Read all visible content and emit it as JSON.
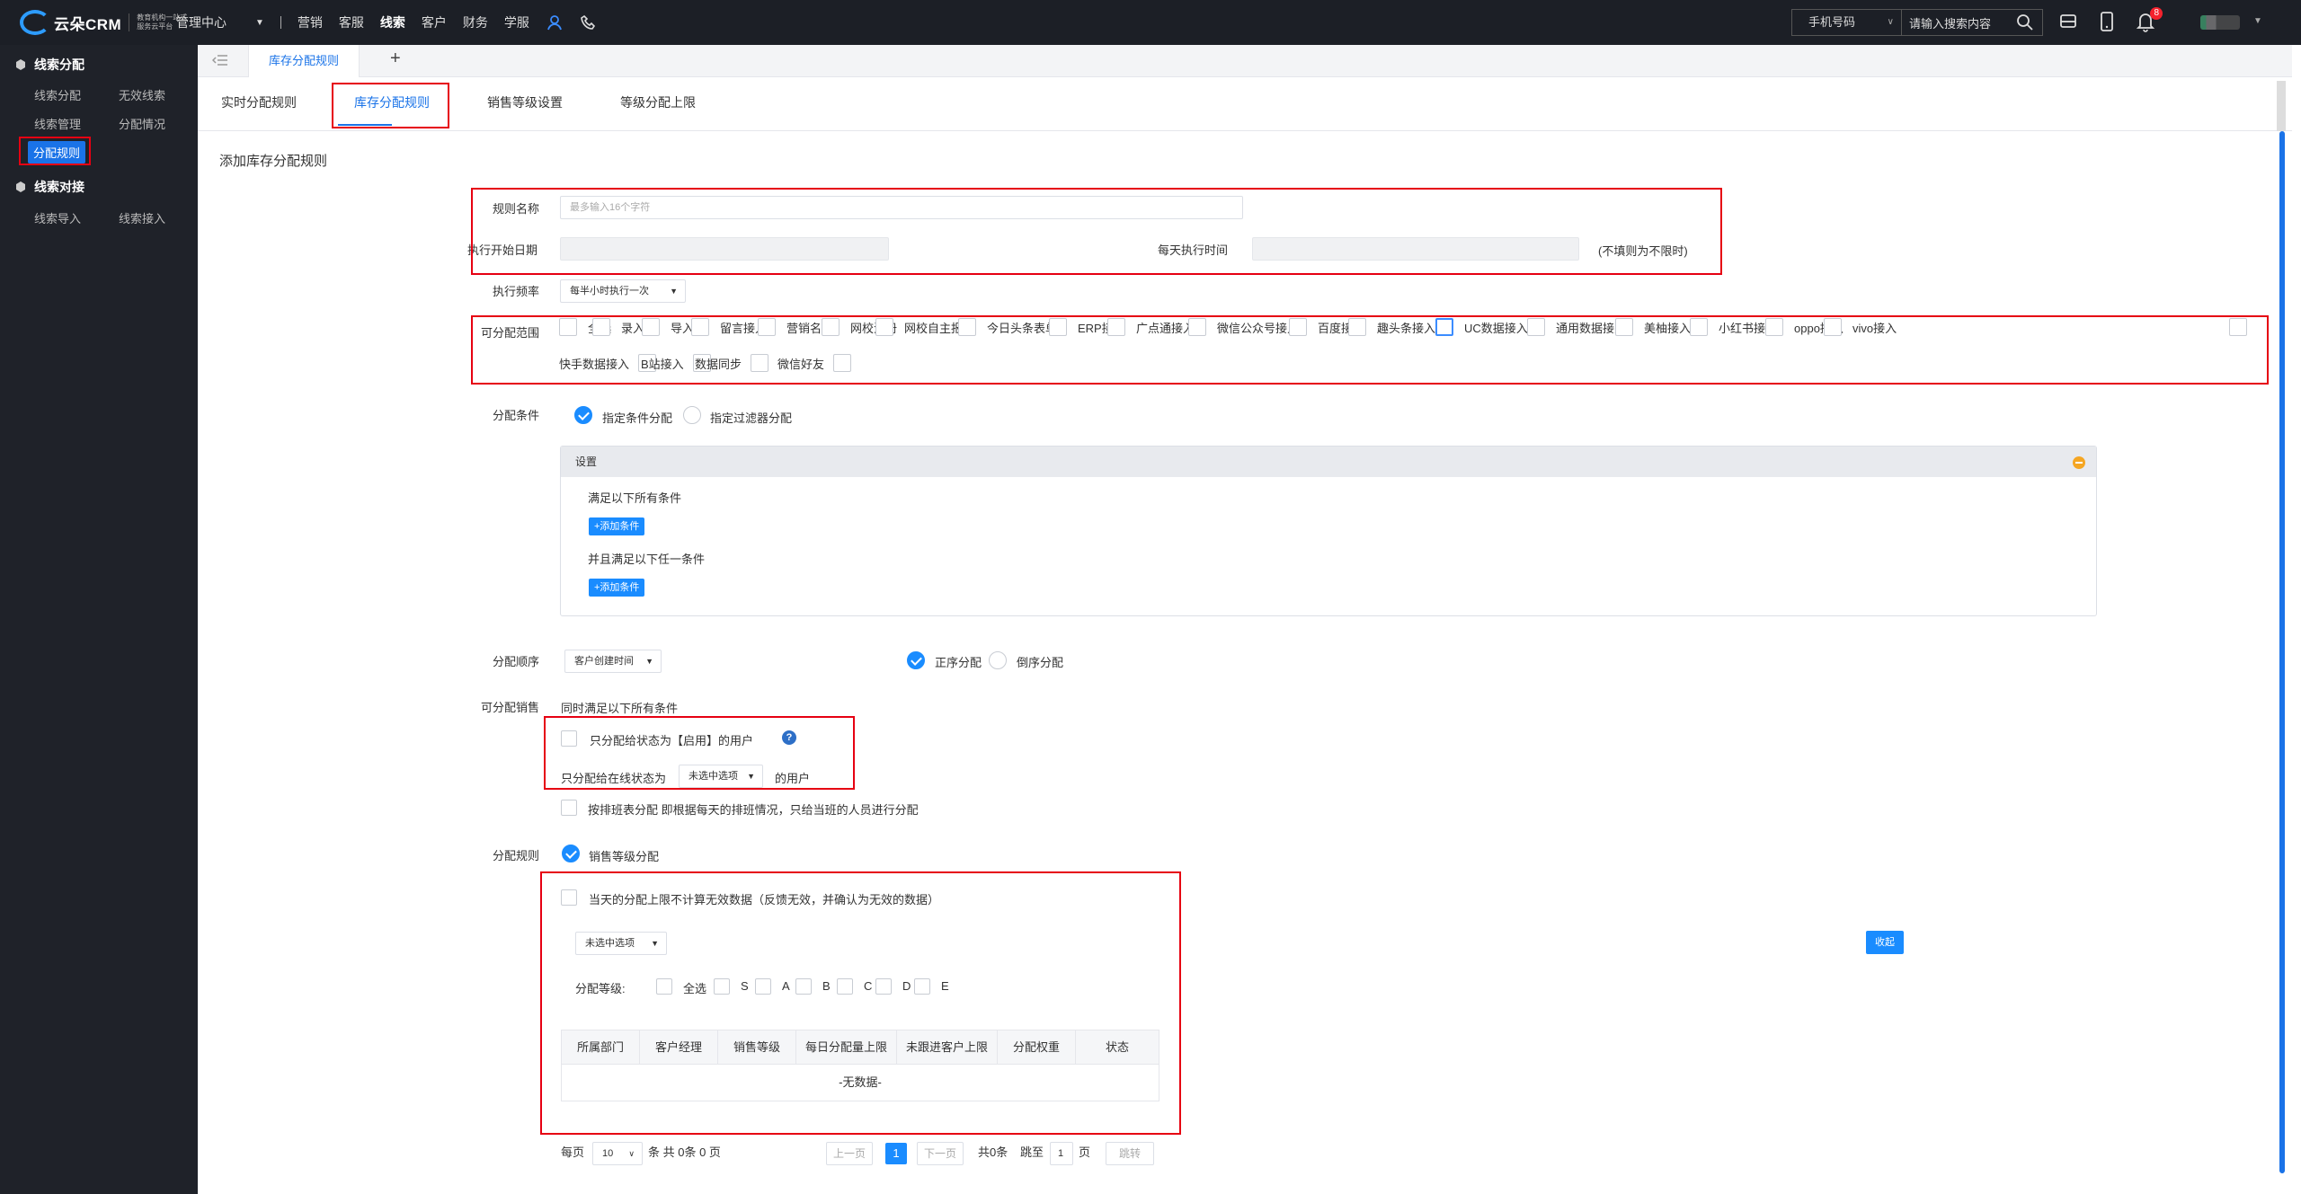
{
  "header": {
    "logo_text": "云朵CRM",
    "logo_sub": "教育机构一站式服务云平台",
    "nav_mgmt": "管理中心",
    "nav_items": [
      "营销",
      "客服",
      "线索",
      "客户",
      "财务",
      "学服"
    ],
    "search_type": "手机号码",
    "search_placeholder": "请输入搜索内容",
    "notif_count": "8"
  },
  "sidebar": {
    "group1": "线索分配",
    "group1_items": [
      "线索分配",
      "无效线索",
      "线索管理",
      "分配情况",
      "分配规则"
    ],
    "group2": "线索对接",
    "group2_items": [
      "线索导入",
      "线索接入"
    ]
  },
  "tabs": {
    "main": "库存分配规则",
    "add": "+"
  },
  "subtabs": [
    "实时分配规则",
    "库存分配规则",
    "销售等级设置",
    "等级分配上限"
  ],
  "form": {
    "page_title": "添加库存分配规则",
    "rule_name_label": "规则名称",
    "rule_name_placeholder": "最多输入16个字符",
    "start_date_label": "执行开始日期",
    "daily_time_label": "每天执行时间",
    "daily_time_note": "(不填则为不限时)",
    "frequency_label": "执行频率",
    "frequency_value": "每半小时执行一次",
    "scope_label": "可分配范围",
    "scope_items": [
      "全选",
      "录入",
      "导入",
      "留言接入",
      "营销名片",
      "网校注册",
      "网校自主报名",
      "今日头条表单",
      "ERP接入",
      "广点通接入",
      "微信公众号接入",
      "百度接入",
      "趣头条接入",
      "UC数据接入",
      "通用数据接入",
      "美柚接入",
      "小红书接入",
      "oppo接入",
      "vivo接入",
      "快手数据接入",
      "B站接入",
      "数据同步",
      "微信好友"
    ],
    "condition_label": "分配条件",
    "condition_opt1": "指定条件分配",
    "condition_opt2": "指定过滤器分配",
    "settings_title": "设置",
    "all_conditions": "满足以下所有条件",
    "add_condition": "+添加条件",
    "any_condition": "并且满足以下任一条件",
    "order_label": "分配顺序",
    "order_value": "客户创建时间",
    "order_asc": "正序分配",
    "order_desc": "倒序分配",
    "sales_label": "可分配销售",
    "sales_all": "同时满足以下所有条件",
    "only_enabled": "只分配给状态为【启用】的用户",
    "online_prefix": "只分配给在线状态为",
    "online_select": "未选中选项",
    "online_suffix": "的用户",
    "shift_text": "按排班表分配 即根据每天的排班情况，只给当班的人员进行分配",
    "rule_label": "分配规则",
    "rule_opt": "销售等级分配",
    "exclude_invalid": "当天的分配上限不计算无效数据（反馈无效，并确认为无效的数据）",
    "level_select": "未选中选项",
    "collapse_btn": "收起",
    "level_label": "分配等级:",
    "levels": [
      "全选",
      "S",
      "A",
      "B",
      "C",
      "D",
      "E"
    ],
    "table_headers": [
      "所属部门",
      "客户经理",
      "销售等级",
      "每日分配量上限",
      "未跟进客户上限",
      "分配权重",
      "状态"
    ],
    "table_empty": "-无数据-"
  },
  "pagination": {
    "per_page": "每页",
    "per_page_value": "10",
    "summary": "条 共 0条 0 页",
    "prev": "上一页",
    "current": "1",
    "next": "下一页",
    "total": "共0条",
    "jump_to": "跳至",
    "jump_value": "1",
    "page_unit": "页",
    "jump_btn": "跳转"
  },
  "colors": {
    "accent": "#1a8cff",
    "highlight_box": "#e60012",
    "topbar": "#1c1f26",
    "sidebar": "#1f2229"
  }
}
